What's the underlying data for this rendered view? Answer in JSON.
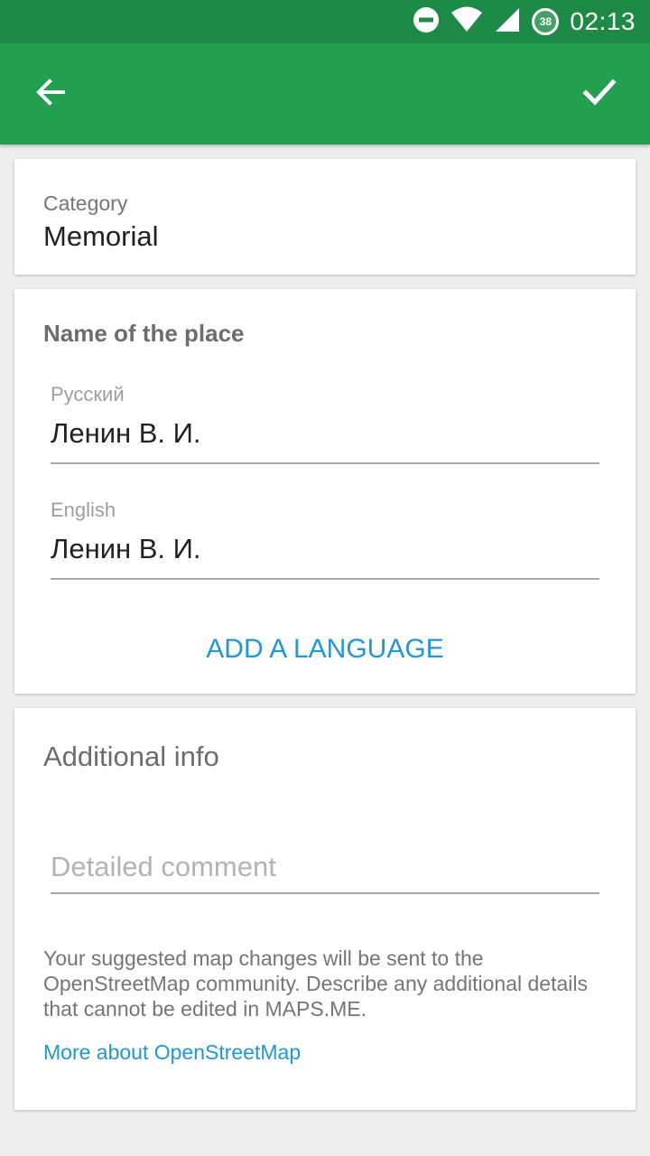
{
  "status_bar": {
    "time": "02:13",
    "battery_level": "38",
    "icons": [
      "do-not-disturb-icon",
      "wifi-icon",
      "signal-icon",
      "battery-icon"
    ]
  },
  "toolbar": {
    "back_icon": "arrow-left-icon",
    "done_icon": "check-icon",
    "background_color": "#22a050"
  },
  "category": {
    "label": "Category",
    "value": "Memorial"
  },
  "name_section": {
    "title": "Name of the place",
    "fields": [
      {
        "language": "Русский",
        "value": "Ленин В. И."
      },
      {
        "language": "English",
        "value": "Ленин В. И."
      }
    ],
    "add_language_label": "ADD A LANGUAGE"
  },
  "additional_info": {
    "title": "Additional info",
    "comment_placeholder": "Detailed comment",
    "description": "Your suggested map changes will be sent to the OpenStreetMap community. Describe any additional details that cannot be edited in MAPS.ME.",
    "link_label": "More about OpenStreetMap"
  },
  "colors": {
    "status_bar": "#1e8a47",
    "link": "#2196d9"
  }
}
